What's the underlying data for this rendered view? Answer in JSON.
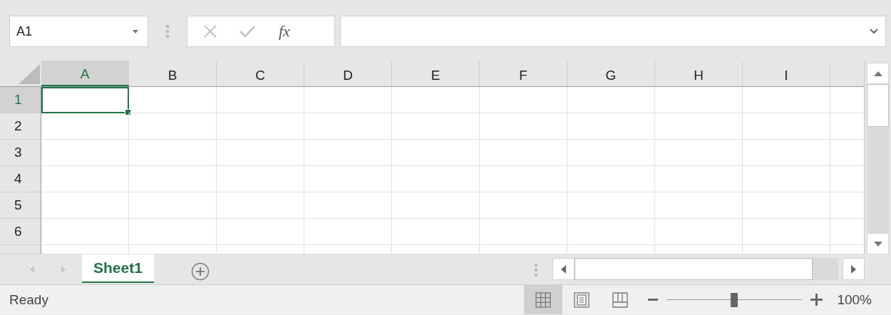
{
  "name_box": {
    "value": "A1"
  },
  "formula_bar": {
    "function_label": "fx"
  },
  "columns": [
    {
      "label": "A",
      "selected": true
    },
    {
      "label": "B",
      "selected": false
    },
    {
      "label": "C",
      "selected": false
    },
    {
      "label": "D",
      "selected": false
    },
    {
      "label": "E",
      "selected": false
    },
    {
      "label": "F",
      "selected": false
    },
    {
      "label": "G",
      "selected": false
    },
    {
      "label": "H",
      "selected": false
    },
    {
      "label": "I",
      "selected": false
    }
  ],
  "rows": [
    {
      "label": "1",
      "selected": true
    },
    {
      "label": "2",
      "selected": false
    },
    {
      "label": "3",
      "selected": false
    },
    {
      "label": "4",
      "selected": false
    },
    {
      "label": "5",
      "selected": false
    },
    {
      "label": "6",
      "selected": false
    }
  ],
  "sheet_tabs": [
    {
      "label": "Sheet1",
      "selected": true
    }
  ],
  "status_bar": {
    "text": "Ready",
    "views": [
      {
        "kind": "normal",
        "selected": true
      },
      {
        "kind": "page_layout",
        "selected": false
      },
      {
        "kind": "page_break",
        "selected": false
      }
    ],
    "zoom": {
      "level": 0.5,
      "reading": "100%"
    }
  }
}
